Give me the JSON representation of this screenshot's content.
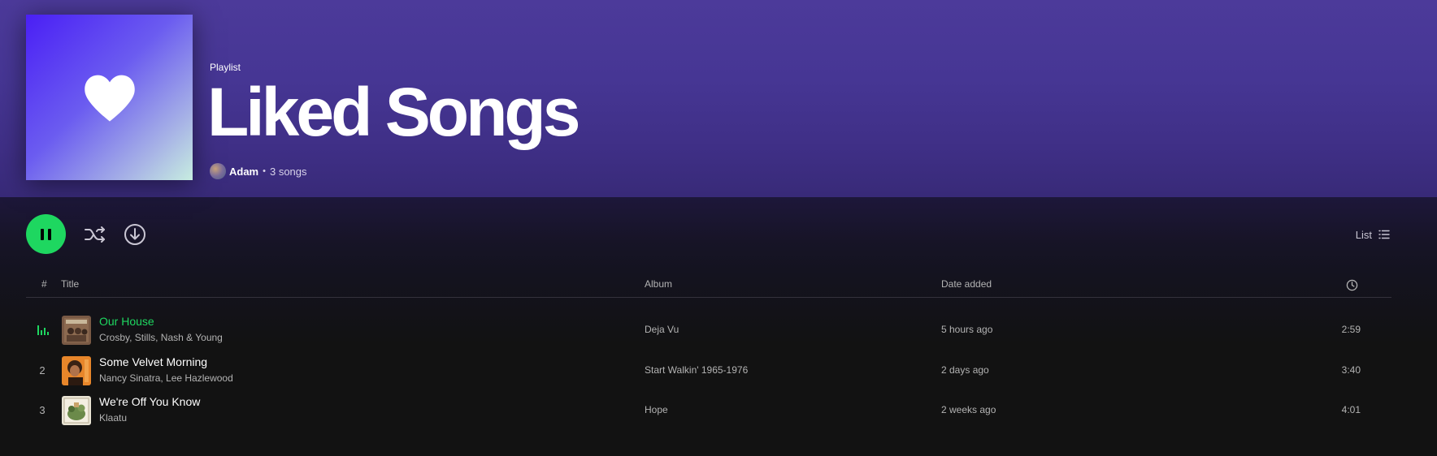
{
  "playlist": {
    "type_label": "Playlist",
    "title": "Liked Songs",
    "owner": "Adam",
    "separator": "•",
    "song_count": "3 songs",
    "cover_icon": "heart-icon"
  },
  "actions": {
    "play_state": "playing",
    "play_icon": "pause-icon",
    "shuffle_icon": "shuffle-icon",
    "download_icon": "download-icon",
    "view_label": "List",
    "view_icon": "list-view-icon"
  },
  "columns": {
    "number": "#",
    "title": "Title",
    "album": "Album",
    "date_added": "Date added",
    "duration_icon": "clock-icon"
  },
  "tracks": [
    {
      "number": "1",
      "title": "Our House",
      "artist": "Crosby, Stills, Nash & Young",
      "album": "Deja Vu",
      "date_added": "5 hours ago",
      "duration": "2:59",
      "playing": true
    },
    {
      "number": "2",
      "title": "Some Velvet Morning",
      "artist": "Nancy Sinatra, Lee Hazlewood",
      "album": "Start Walkin' 1965-1976",
      "date_added": "2 days ago",
      "duration": "3:40",
      "playing": false
    },
    {
      "number": "3",
      "title": "We're Off You Know",
      "artist": "Klaatu",
      "album": "Hope",
      "date_added": "2 weeks ago",
      "duration": "4:01",
      "playing": false
    }
  ],
  "colors": {
    "accent": "#1ed760",
    "header_bg": "#4c3a9a",
    "page_bg": "#121212"
  }
}
